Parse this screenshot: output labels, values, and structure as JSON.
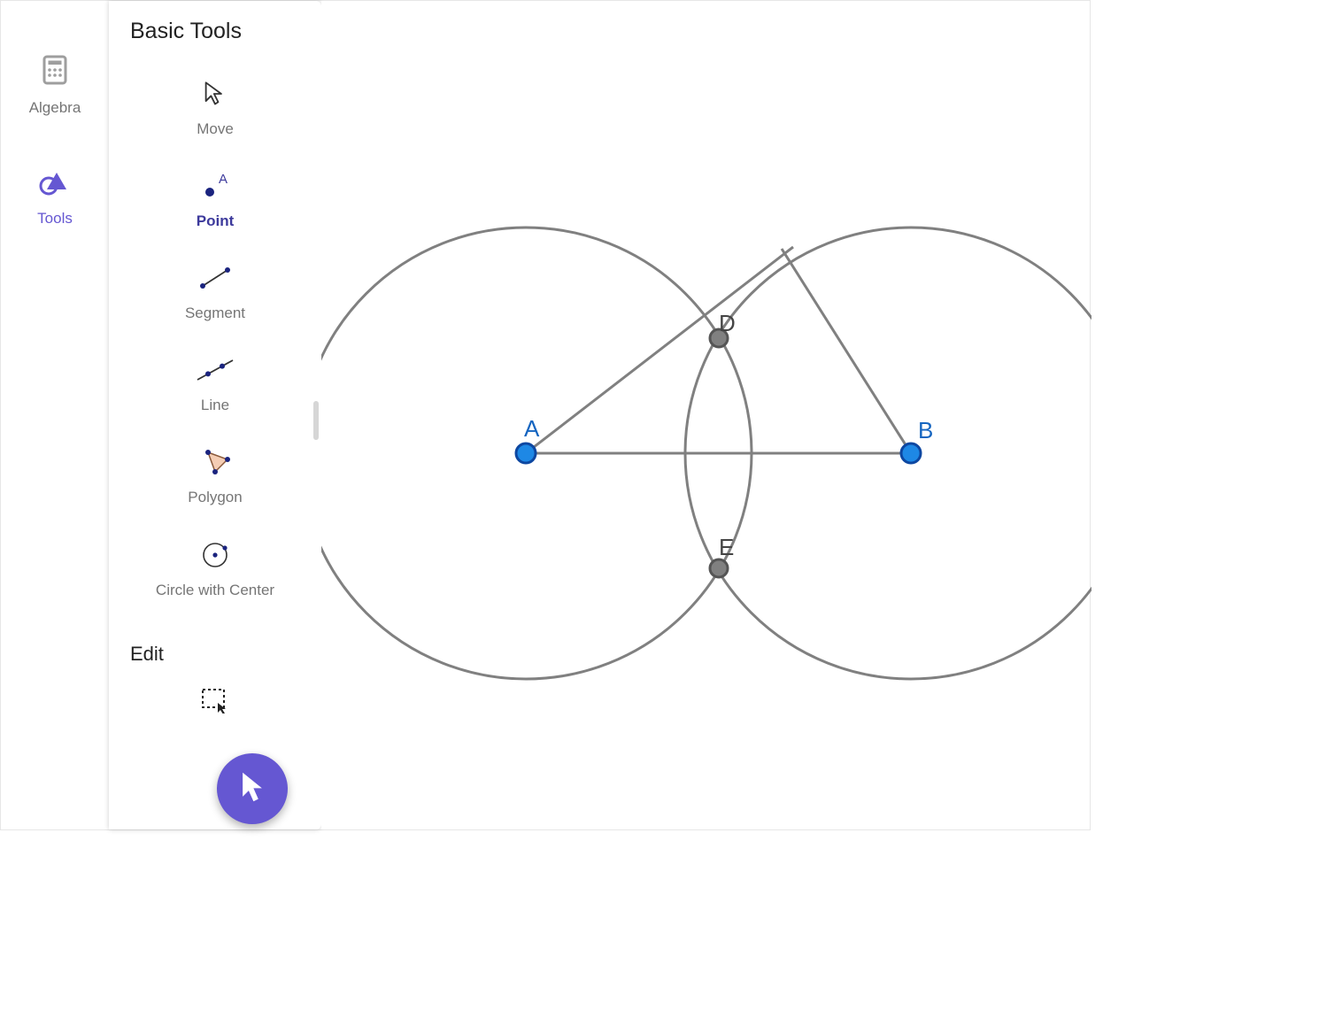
{
  "nav": {
    "algebra": "Algebra",
    "tools": "Tools"
  },
  "panel": {
    "heading": "Basic Tools",
    "edit_heading": "Edit",
    "tools": {
      "move": "Move",
      "point": "Point",
      "segment": "Segment",
      "line": "Line",
      "polygon": "Polygon",
      "circle": "Circle with Center"
    }
  },
  "canvas": {
    "labels": {
      "A": "A",
      "B": "B",
      "D": "D",
      "E": "E"
    }
  },
  "colors": {
    "accent": "#6557d2",
    "point_blue": "#1565C0",
    "point_blue_fill": "#1E88E5",
    "label_blue": "#1565C0",
    "geom_gray": "#808080",
    "label_gray": "#444"
  }
}
